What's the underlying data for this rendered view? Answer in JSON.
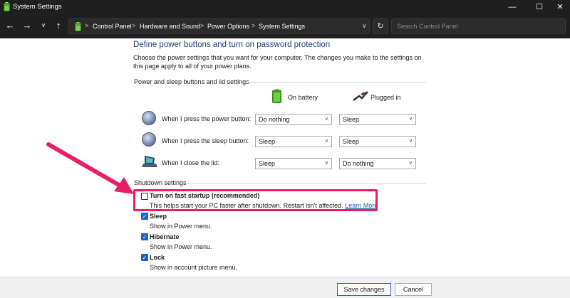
{
  "window": {
    "title": "System Settings",
    "min_glyph": "—",
    "max_glyph": "☐",
    "close_glyph": "✕"
  },
  "addressbar": {
    "back_glyph": "←",
    "forward_glyph": "→",
    "dropdown_glyph": "∨",
    "up_glyph": "↑",
    "breadcrumb": [
      "Control Panel",
      "Hardware and Sound",
      "Power Options",
      "System Settings"
    ],
    "separator": ">",
    "refresh_glyph": "↻",
    "search_placeholder": "Search Control Panel"
  },
  "main": {
    "heading": "Define power buttons and turn on password protection",
    "description": "Choose the power settings that you want for your computer. The changes you make to the settings on this page apply to all of your power plans.",
    "buttons_section_label": "Power and sleep buttons and lid settings",
    "columns": {
      "on_battery": "On battery",
      "plugged_in": "Plugged in"
    },
    "rows": [
      {
        "label": "When I press the power button:",
        "battery": "Do nothing",
        "plugged": "Sleep"
      },
      {
        "label": "When I press the sleep button:",
        "battery": "Sleep",
        "plugged": "Sleep"
      },
      {
        "label": "When I close the lid:",
        "battery": "Sleep",
        "plugged": "Do nothing"
      }
    ],
    "select_chevron": "∨",
    "shutdown_section_label": "Shutdown settings",
    "options": [
      {
        "label": "Turn on fast startup (recommended)",
        "desc": "This helps start your PC faster after shutdown. Restart isn't affected.",
        "link": "Learn More",
        "checked": false
      },
      {
        "label": "Sleep",
        "desc": "Show in Power menu.",
        "checked": true
      },
      {
        "label": "Hibernate",
        "desc": "Show in Power menu.",
        "checked": true
      },
      {
        "label": "Lock",
        "desc": "Show in account picture menu.",
        "checked": true
      }
    ],
    "check_glyph": "✓"
  },
  "footer": {
    "save_label": "Save changes",
    "cancel_label": "Cancel"
  },
  "colors": {
    "heading": "#1e3f7a",
    "accent": "#1a62c4",
    "highlight": "#ea1f63",
    "titlebar": "#1f1f1f"
  },
  "icons": {
    "app": "battery-icon",
    "power_button": "power-icon",
    "sleep_button": "sleep-icon",
    "lid": "laptop-lid-icon",
    "battery_column": "battery-icon",
    "plugged_column": "power-plug-icon",
    "annotation": "arrow-annotation-icon"
  }
}
